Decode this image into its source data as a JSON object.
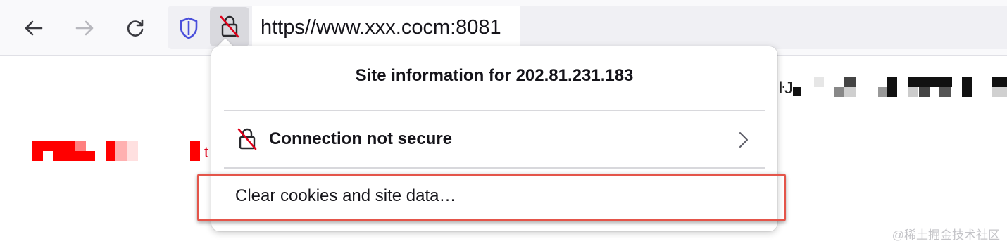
{
  "toolbar": {
    "back_icon": "arrow-left-icon",
    "forward_icon": "arrow-right-icon",
    "reload_icon": "reload-icon",
    "tracking_protection_icon": "shield-icon",
    "site_info_icon": "lock-insecure-icon",
    "url": "https//www.xxx.cocm:8081"
  },
  "popup": {
    "title": "Site information for 202.81.231.183",
    "connection_label": "Connection not secure",
    "connection_icon": "lock-insecure-icon",
    "chevron_icon": "chevron-right-icon",
    "clear_data_label": "Clear cookies and site data…"
  },
  "page": {
    "partial_text_left": "t",
    "partial_text_right": "ŀJ"
  },
  "watermark": "@稀土掘金技术社区",
  "colors": {
    "accent": "#4a4fdb",
    "insecure": "#e0001a",
    "highlight": "#e4554a"
  }
}
